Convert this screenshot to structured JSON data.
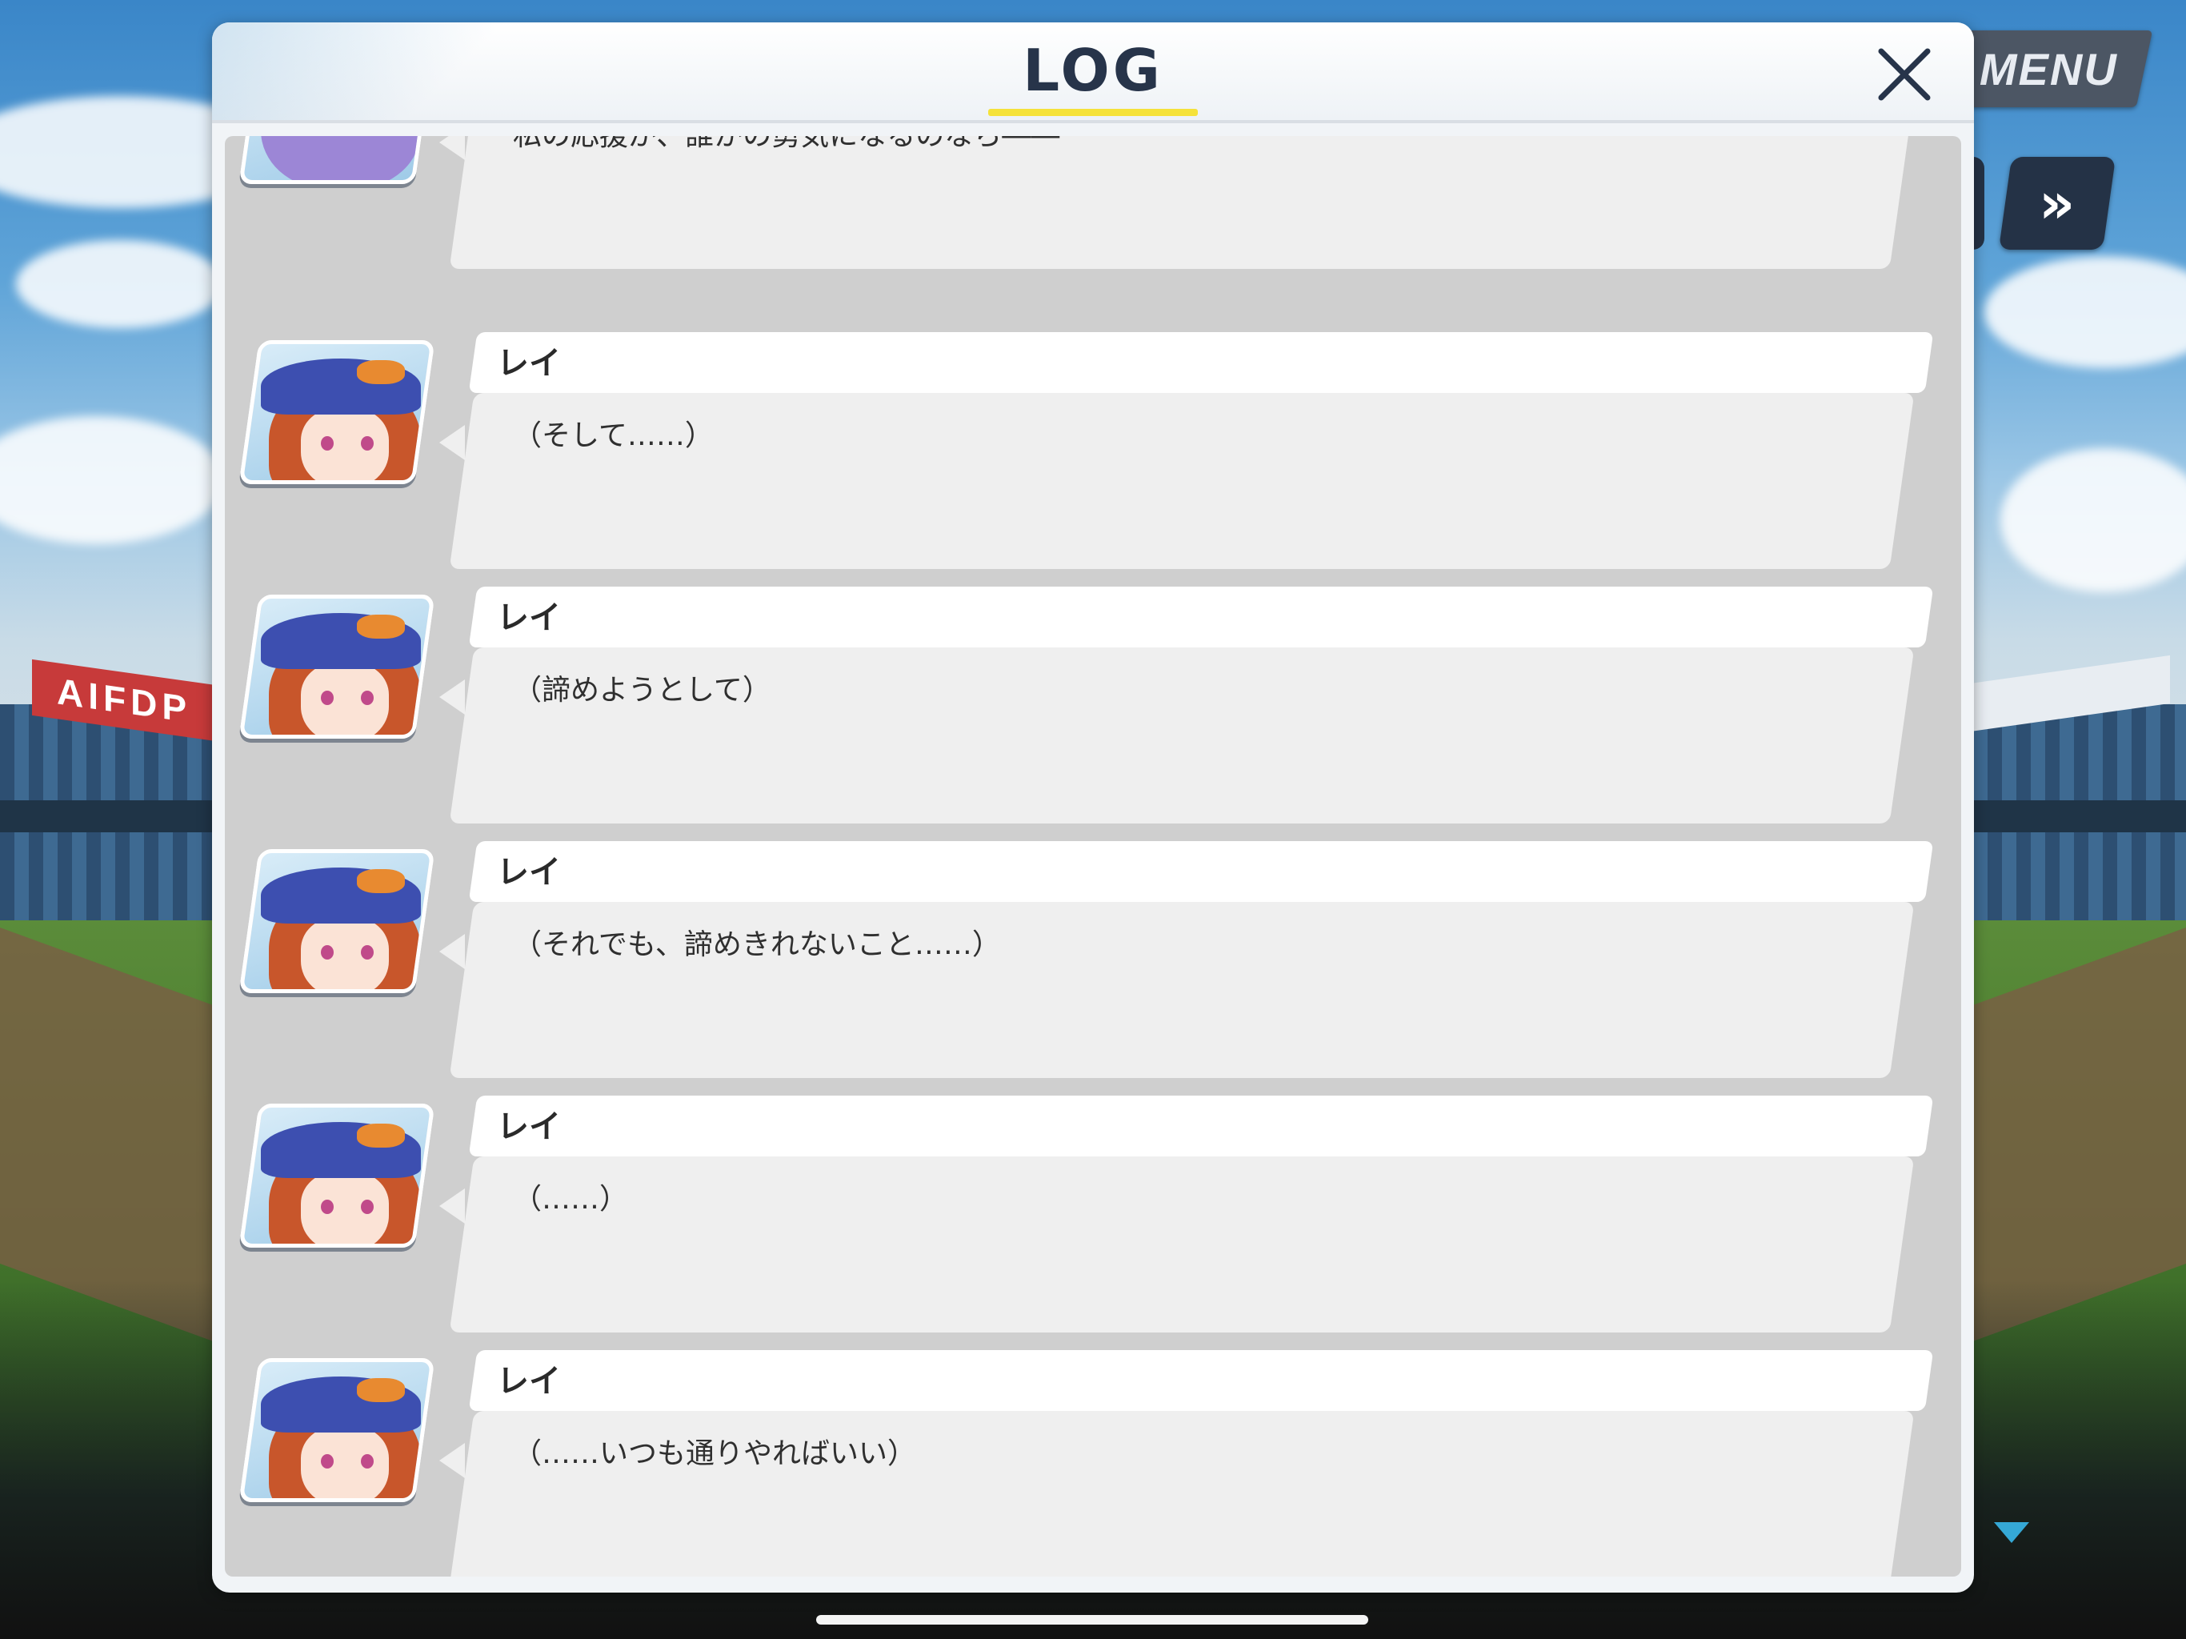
{
  "window": {
    "title": "LOG"
  },
  "controls": {
    "menu_label": "MENU",
    "fast_forward_icon": "»",
    "close_icon": "close-icon"
  },
  "log_entries": [
    {
      "speaker": "",
      "message": "私の応援が、誰かの勇気になるのなら――",
      "avatar": "purple-haired-girl-portrait"
    },
    {
      "speaker": "レイ",
      "message": "（そして……）",
      "avatar": "rei-portrait"
    },
    {
      "speaker": "レイ",
      "message": "（諦めようとして）",
      "avatar": "rei-portrait"
    },
    {
      "speaker": "レイ",
      "message": "（それでも、諦めきれないこと……）",
      "avatar": "rei-portrait"
    },
    {
      "speaker": "レイ",
      "message": "（……）",
      "avatar": "rei-portrait"
    },
    {
      "speaker": "レイ",
      "message": "（……いつも通りやればいい）",
      "avatar": "rei-portrait"
    }
  ],
  "colors": {
    "title": "#27344a",
    "underline": "#f5e23a",
    "log_background": "#cfcfcf",
    "bubble": "#efefef",
    "menu_button": "#4c5664"
  },
  "background_signage": {
    "left": "AIFDP"
  }
}
